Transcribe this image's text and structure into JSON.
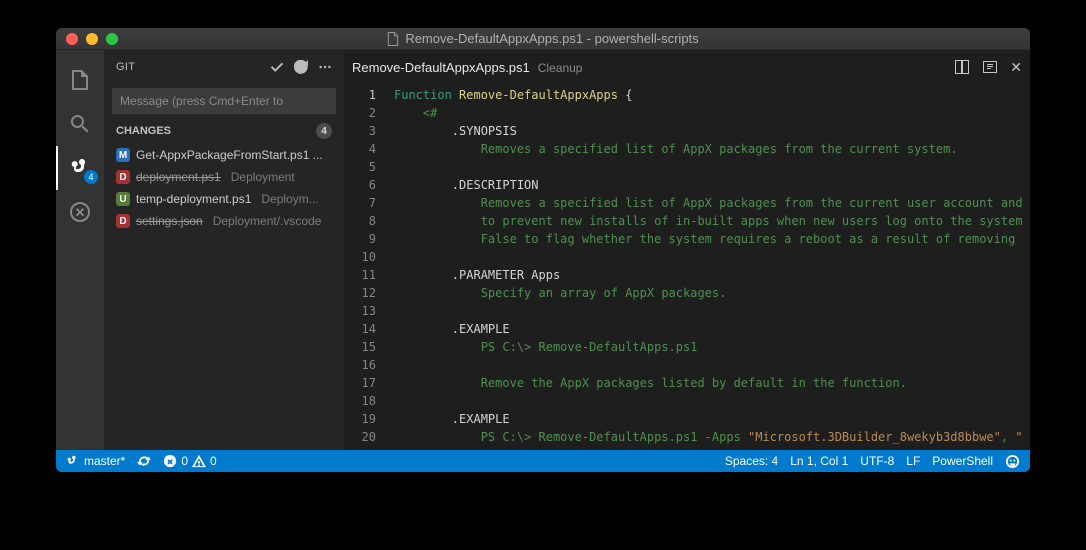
{
  "window": {
    "title": "Remove-DefaultAppxApps.ps1 - powershell-scripts"
  },
  "activitybar": {
    "scm_badge": "4"
  },
  "sidebar": {
    "title": "GIT",
    "commit_placeholder": "Message (press Cmd+Enter to",
    "section_label": "CHANGES",
    "changes_count": "4",
    "items": [
      {
        "status": "M",
        "name": "Get-AppxPackageFromStart.ps1 ...",
        "path": "",
        "strike": false
      },
      {
        "status": "D",
        "name": "deployment.ps1",
        "path": "Deployment",
        "strike": true
      },
      {
        "status": "U",
        "name": "temp-deployment.ps1",
        "path": "Deploym...",
        "strike": false
      },
      {
        "status": "D",
        "name": "settings.json",
        "path": "Deployment/.vscode",
        "strike": true
      }
    ]
  },
  "tab": {
    "filename": "Remove-DefaultAppxApps.ps1",
    "description": "Cleanup"
  },
  "code": {
    "lines": [
      {
        "n": 1,
        "html": "<span class='kw'>Function</span> <span class='fn'>Remove-DefaultAppxApps</span> <span class='pn'>{</span>"
      },
      {
        "n": 2,
        "html": "    <span class='cm'>&lt;#</span>"
      },
      {
        "n": 3,
        "html": "        <span class='lb'>.SYNOPSIS</span>"
      },
      {
        "n": 4,
        "html": "            <span class='cm'>Removes a specified list of AppX packages from the current system.</span>"
      },
      {
        "n": 5,
        "html": ""
      },
      {
        "n": 6,
        "html": "        <span class='lb'>.DESCRIPTION</span>"
      },
      {
        "n": 7,
        "html": "            <span class='cm'>Removes a specified list of AppX packages from the current user account and</span>"
      },
      {
        "n": 8,
        "html": "            <span class='cm'>to prevent new installs of in-built apps when new users log onto the system</span>"
      },
      {
        "n": 9,
        "html": "            <span class='cm'>False to flag whether the system requires a reboot as a result of removing </span>"
      },
      {
        "n": 10,
        "html": ""
      },
      {
        "n": 11,
        "html": "        <span class='lb'>.PARAMETER Apps</span>"
      },
      {
        "n": 12,
        "html": "            <span class='cm'>Specify an array of AppX packages.</span>"
      },
      {
        "n": 13,
        "html": ""
      },
      {
        "n": 14,
        "html": "        <span class='lb'>.EXAMPLE</span>"
      },
      {
        "n": 15,
        "html": "            <span class='cm'>PS C:\\&gt; Remove-DefaultApps.ps1</span>"
      },
      {
        "n": 16,
        "html": ""
      },
      {
        "n": 17,
        "html": "            <span class='cm'>Remove the AppX packages listed by default in the function.</span>"
      },
      {
        "n": 18,
        "html": ""
      },
      {
        "n": 19,
        "html": "        <span class='lb'>.EXAMPLE</span>"
      },
      {
        "n": 20,
        "html": "            <span class='cm'>PS C:\\&gt; Remove-DefaultApps.ps1 -Apps </span><span class='str'>\"Microsoft.3DBuilder_8wekyb3d8bbwe\"</span><span class='cm'>, </span><span class='str'>\"</span>"
      }
    ]
  },
  "statusbar": {
    "branch_label": "master*",
    "errors": "0",
    "warnings": "0",
    "spaces": "Spaces: 4",
    "position": "Ln 1, Col 1",
    "encoding": "UTF-8",
    "eol": "LF",
    "language": "PowerShell"
  }
}
